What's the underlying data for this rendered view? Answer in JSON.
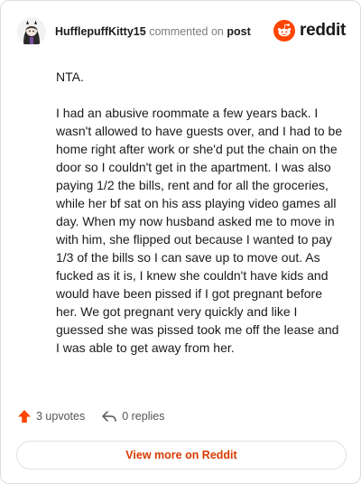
{
  "header": {
    "username": "HufflepuffKitty15",
    "action_text": "commented on",
    "post_link": "post",
    "brand": "reddit"
  },
  "comment": {
    "paragraphs": [
      "NTA.",
      "I had an abusive roommate a few years back. I wasn't allowed to have guests over, and I had to be home right after work or she'd put the chain on the door so I couldn't get in the apartment. I was also paying 1/2 the bills, rent and for all the groceries, while her bf sat on his ass playing video games all day. When my now husband asked me to move in with him, she flipped out because I wanted to pay 1/3 of the bills so I can save up to move out. As fucked as it is, I knew she couldn't have kids and would have been pissed if I got pregnant before her. We got pregnant very quickly and like I guessed she was pissed took me off the lease and I was able to get away from her."
    ]
  },
  "actions": {
    "upvotes": "3 upvotes",
    "replies": "0 replies"
  },
  "view_more": "View more on Reddit",
  "colors": {
    "brand_orange": "#ff4500",
    "link_orange": "#d93a00"
  }
}
